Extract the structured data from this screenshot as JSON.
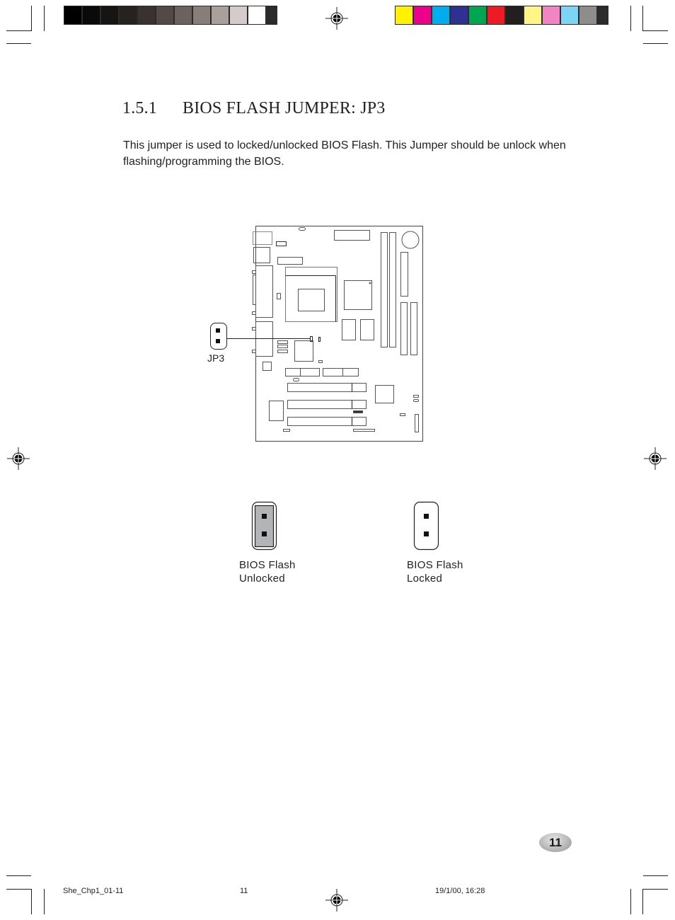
{
  "color_bars": {
    "grayscale": [
      "#000000",
      "#0b0a08",
      "#171513",
      "#26221f",
      "#3a3230",
      "#534a47",
      "#6b625f",
      "#887e79",
      "#a9a09c",
      "#d3cccb",
      "#ffffff"
    ],
    "process": [
      "#fff200",
      "#ec008c",
      "#00aeef",
      "#2e3192",
      "#00a651",
      "#ed1c24",
      "#231f20",
      "#fff685",
      "#f384c4",
      "#7dd5f6",
      "#8f8c8c"
    ]
  },
  "heading": {
    "number": "1.5.1",
    "title": "BIOS FLASH JUMPER: JP3"
  },
  "body_text": "This jumper is used to locked/unlocked BIOS Flash. This Jumper should be unlock when flashing/programming the BIOS.",
  "diagram": {
    "callout_label": "JP3"
  },
  "jumper_settings": [
    {
      "line1": "BIOS Flash",
      "line2": "Unlocked",
      "state": "jumper-on"
    },
    {
      "line1": "BIOS Flash",
      "line2": "Locked",
      "state": "jumper-off"
    }
  ],
  "page_number": "11",
  "footer": {
    "file": "She_Chp1_01-11",
    "page": "11",
    "timestamp": "19/1/00, 16:28"
  }
}
